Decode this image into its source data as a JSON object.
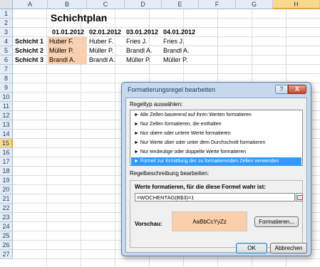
{
  "sheet": {
    "columns": [
      "A",
      "B",
      "C",
      "D",
      "E",
      "F",
      "G",
      "H"
    ],
    "rows": [
      "1",
      "2",
      "3",
      "4",
      "5",
      "6",
      "7",
      "8",
      "9",
      "10",
      "11",
      "12",
      "13",
      "14",
      "15",
      "16",
      "17",
      "18",
      "19",
      "20",
      "21",
      "22",
      "23",
      "24",
      "25",
      "26",
      "27"
    ],
    "selected_column": "H",
    "selected_row": "15",
    "title": "Schichtplan",
    "dates": [
      "01.01.2012",
      "02.01.2012",
      "03.01.2012",
      "04.01.2012"
    ],
    "shifts": [
      {
        "label": "Schicht 1",
        "names": [
          "Huber F.",
          "Huber F.",
          "Fries J.",
          "Fries J."
        ]
      },
      {
        "label": "Schicht 2",
        "names": [
          "Müller P.",
          "Müller P.",
          "Brandl A.",
          "Brandl A."
        ]
      },
      {
        "label": "Schicht 3",
        "names": [
          "Brandl A.",
          "Brandl A.",
          "Müller P.",
          "Müller P."
        ]
      }
    ],
    "highlight_color": "#fbcfac"
  },
  "dialog": {
    "title": "Formatierungsregel bearbeiten",
    "help_label": "?",
    "close_label": "X",
    "rule_type_label": "Regeltyp auswählen:",
    "rule_types": [
      "► Alle Zellen basierend auf ihren Werten formatieren",
      "► Nur Zellen formatieren, die enthalten",
      "► Nur obere oder untere Werte formatieren",
      "► Nur Werte über oder unter dem Durchschnitt formatieren",
      "► Nur eindeutige oder doppelte Werte formatieren",
      "► Formel zur Ermittlung der zu formatierenden Zellen verwenden"
    ],
    "selected_rule_index": 5,
    "description_label": "Regelbeschreibung bearbeiten:",
    "formula_heading": "Werte formatieren, für die diese Formel wahr ist:",
    "formula_value": "=WOCHENTAG(B$3)=1",
    "preview_label": "Vorschau:",
    "preview_text": "AaBbCcYyZz",
    "format_button": "Formatieren...",
    "ok_button": "OK",
    "cancel_button": "Abbrechen"
  }
}
